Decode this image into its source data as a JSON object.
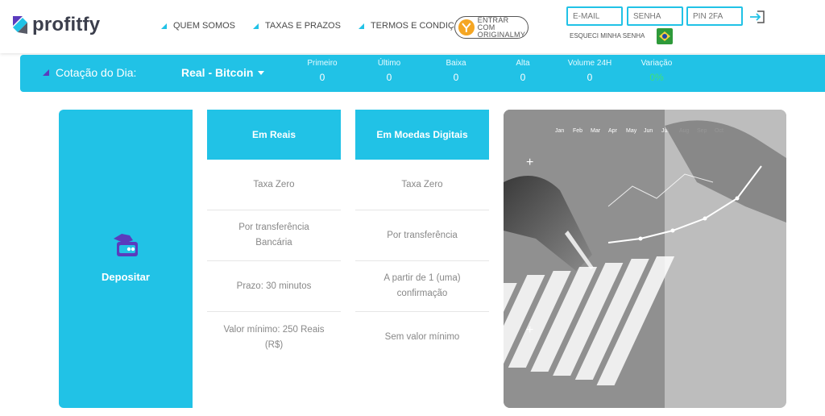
{
  "brand": {
    "name": "profitfy",
    "colors": {
      "accent": "#21c2e6",
      "purple": "#5b3bbd",
      "dark": "#3b3e4c"
    }
  },
  "nav": [
    {
      "label": "QUEM SOMOS"
    },
    {
      "label": "TAXAS E PRAZOS"
    },
    {
      "label": "TERMOS E CONDIÇÕES"
    }
  ],
  "originalmy": {
    "line1": "ENTRAR COM",
    "line2": "ORIGINALMY"
  },
  "login": {
    "email_placeholder": "E-MAIL",
    "password_placeholder": "SENHA",
    "pin_placeholder": "PIN 2FA",
    "forgot": "ESQUECI MINHA SENHA"
  },
  "ticker": {
    "title": "Cotação do Dia:",
    "pair": "Real - Bitcoin",
    "stats": [
      {
        "label": "Primeiro",
        "value": "0"
      },
      {
        "label": "Último",
        "value": "0"
      },
      {
        "label": "Baixa",
        "value": "0"
      },
      {
        "label": "Alta",
        "value": "0"
      },
      {
        "label": "Volume 24H",
        "value": "0"
      },
      {
        "label": "Variação",
        "value": "0%"
      }
    ]
  },
  "deposit": {
    "label": "Depositar",
    "icon": "wallet-card-icon"
  },
  "columns": [
    {
      "header": "Em Reais",
      "rows": [
        "Taxa Zero",
        "Por transferência Bancária",
        "Prazo: 30 minutos",
        "Valor mínimo: 250 Reais (R$)"
      ]
    },
    {
      "header": "Em Moedas Digitais",
      "rows": [
        "Taxa Zero",
        "Por transferência",
        "A partir de 1 (uma) confirmação",
        "Sem valor mínimo"
      ]
    }
  ],
  "photo": {
    "chart_month_labels": [
      "Jan",
      "Feb",
      "Mar",
      "Apr",
      "May",
      "Jun",
      "Jul",
      "Aug",
      "Sep",
      "Oct"
    ]
  }
}
